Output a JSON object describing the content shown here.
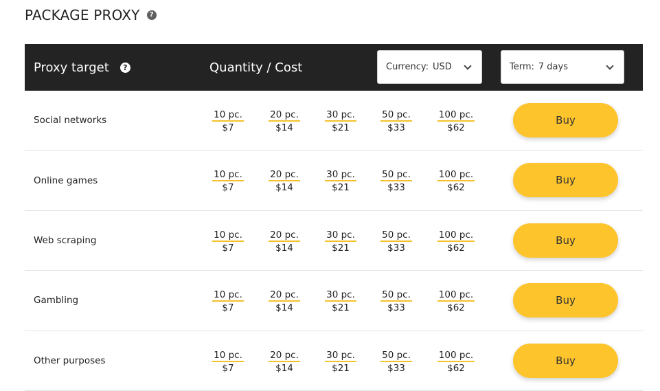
{
  "page": {
    "title": "PACKAGE PROXY",
    "help_icon": "question-circle-icon"
  },
  "header": {
    "proxy_target_label": "Proxy target",
    "quantity_cost_label": "Quantity / Cost",
    "currency": {
      "label": "Currency:",
      "value": "USD"
    },
    "term": {
      "label": "Term:",
      "value": "7 days"
    }
  },
  "colors": {
    "header_bg": "#232323",
    "accent": "#fec42c",
    "underline": "#f5c12b"
  },
  "rows": [
    {
      "label": "Social networks",
      "buy_label": "Buy",
      "options": [
        {
          "qty": "10 pc.",
          "cost": "$7"
        },
        {
          "qty": "20 pc.",
          "cost": "$14"
        },
        {
          "qty": "30 pc.",
          "cost": "$21"
        },
        {
          "qty": "50 pc.",
          "cost": "$33"
        },
        {
          "qty": "100 pc.",
          "cost": "$62"
        }
      ]
    },
    {
      "label": "Online games",
      "buy_label": "Buy",
      "options": [
        {
          "qty": "10 pc.",
          "cost": "$7"
        },
        {
          "qty": "20 pc.",
          "cost": "$14"
        },
        {
          "qty": "30 pc.",
          "cost": "$21"
        },
        {
          "qty": "50 pc.",
          "cost": "$33"
        },
        {
          "qty": "100 pc.",
          "cost": "$62"
        }
      ]
    },
    {
      "label": "Web scraping",
      "buy_label": "Buy",
      "options": [
        {
          "qty": "10 pc.",
          "cost": "$7"
        },
        {
          "qty": "20 pc.",
          "cost": "$14"
        },
        {
          "qty": "30 pc.",
          "cost": "$21"
        },
        {
          "qty": "50 pc.",
          "cost": "$33"
        },
        {
          "qty": "100 pc.",
          "cost": "$62"
        }
      ]
    },
    {
      "label": "Gambling",
      "buy_label": "Buy",
      "options": [
        {
          "qty": "10 pc.",
          "cost": "$7"
        },
        {
          "qty": "20 pc.",
          "cost": "$14"
        },
        {
          "qty": "30 pc.",
          "cost": "$21"
        },
        {
          "qty": "50 pc.",
          "cost": "$33"
        },
        {
          "qty": "100 pc.",
          "cost": "$62"
        }
      ]
    },
    {
      "label": "Other purposes",
      "buy_label": "Buy",
      "options": [
        {
          "qty": "10 pc.",
          "cost": "$7"
        },
        {
          "qty": "20 pc.",
          "cost": "$14"
        },
        {
          "qty": "30 pc.",
          "cost": "$21"
        },
        {
          "qty": "50 pc.",
          "cost": "$33"
        },
        {
          "qty": "100 pc.",
          "cost": "$62"
        }
      ]
    }
  ]
}
